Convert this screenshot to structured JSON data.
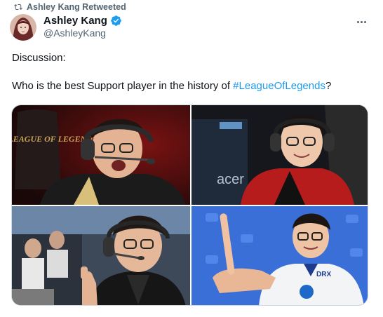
{
  "retweet": {
    "icon": "retweet-icon",
    "text": "Ashley Kang Retweeted"
  },
  "author": {
    "display_name": "Ashley Kang",
    "handle": "@AshleyKang",
    "verified_badge": "verified-badge-icon",
    "avatar": "avatar"
  },
  "more_menu": {
    "icon": "more-options-icon"
  },
  "tweet": {
    "line1": "Discussion:",
    "line2_prefix": "Who is the best Support player in the history of ",
    "hashtag": "#LeagueOfLegends",
    "line2_suffix": "?"
  },
  "media": {
    "photos": [
      {
        "logo_text": "LEAGUE OF LEGENDS"
      },
      {
        "logo_text": "acer"
      },
      {
        "logo_text": ""
      },
      {
        "logo_text": "DRX"
      }
    ]
  },
  "colors": {
    "accent": "#1d9bf0",
    "muted": "#536471",
    "text": "#0f1419",
    "border": "#cfd9de"
  }
}
